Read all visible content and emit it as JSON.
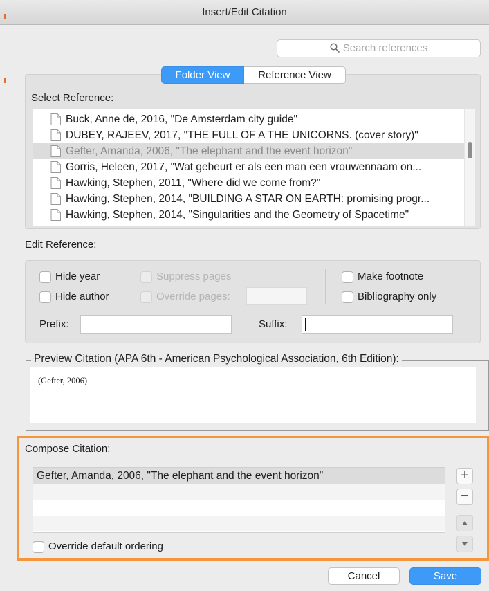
{
  "window": {
    "title": "Insert/Edit Citation"
  },
  "search": {
    "placeholder": "Search references"
  },
  "view_toggle": {
    "folder_view": "Folder View",
    "reference_view": "Reference View",
    "active": "Folder View"
  },
  "select_reference": {
    "label": "Select Reference:",
    "items": [
      {
        "text": "Buck, Anne de, 2016, \"De Amsterdam city guide\"",
        "selected": false
      },
      {
        "text": "DUBEY, RAJEEV, 2017, \"THE FULL OF A THE UNICORNS. (cover story)\"",
        "selected": false
      },
      {
        "text": "Gefter, Amanda, 2006, \"The elephant and the event horizon\"",
        "selected": true
      },
      {
        "text": "Gorris, Heleen, 2017, \"Wat gebeurt er als een man een vrouwennaam on...",
        "selected": false
      },
      {
        "text": "Hawking, Stephen, 2011, \"Where did we come from?\"",
        "selected": false
      },
      {
        "text": "Hawking, Stephen, 2014, \"BUILDING A STAR ON EARTH: promising progr...",
        "selected": false
      },
      {
        "text": "Hawking, Stephen, 2014, \"Singularities and the Geometry of Spacetime\"",
        "selected": false
      }
    ]
  },
  "edit_reference": {
    "label": "Edit Reference:",
    "hide_year": "Hide year",
    "hide_author": "Hide author",
    "suppress_pages": "Suppress pages",
    "override_pages": "Override pages:",
    "make_footnote": "Make footnote",
    "bibliography_only": "Bibliography only",
    "prefix_label": "Prefix:",
    "suffix_label": "Suffix:",
    "prefix_value": "",
    "suffix_value": ""
  },
  "preview": {
    "legend": "Preview Citation (APA 6th - American Psychological Association, 6th Edition):",
    "text": "(Gefter, 2006)"
  },
  "compose": {
    "label": "Compose Citation:",
    "items": [
      "Gefter, Amanda, 2006, \"The elephant and the event horizon\""
    ],
    "add_symbol": "+",
    "remove_symbol": "−",
    "override_ordering": "Override default ordering"
  },
  "buttons": {
    "cancel": "Cancel",
    "save": "Save"
  },
  "colors": {
    "accent": "#3d9af6",
    "highlight": "#f5963c"
  }
}
